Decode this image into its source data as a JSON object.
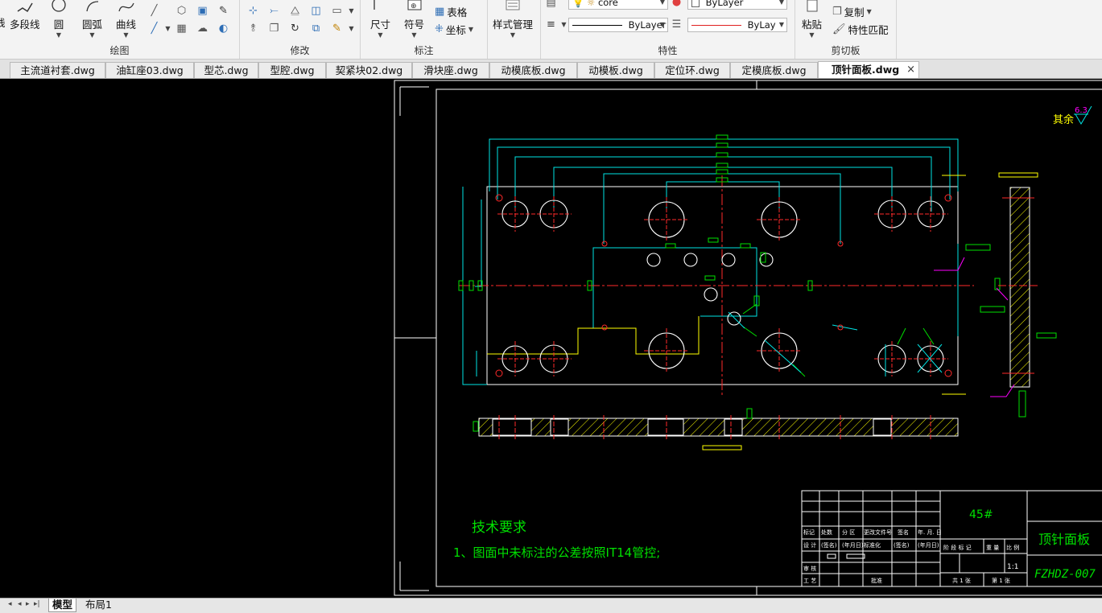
{
  "ribbon": {
    "draw": {
      "title": "绘图",
      "cut_label": "线",
      "polyline": "多段线",
      "circle": "圆",
      "arc": "圆弧",
      "curve": "曲线"
    },
    "modify": {
      "title": "修改"
    },
    "annotate": {
      "title": "标注",
      "dimension": "尺寸",
      "symbol": "符号",
      "table": "表格",
      "coordinate": "坐标"
    },
    "style_manager": "样式管理",
    "properties": {
      "title": "特性",
      "layer_value": "core",
      "color_value": "ByLayer",
      "linetype_value": "ByLayer",
      "lineweight_value": "ByLay"
    },
    "clipboard": {
      "title": "剪切板",
      "paste": "粘贴",
      "copy": "复制",
      "match_props": "特性匹配"
    }
  },
  "tabs": [
    {
      "label": "主流道衬套.dwg",
      "active": false
    },
    {
      "label": "油缸座03.dwg",
      "active": false
    },
    {
      "label": "型芯.dwg",
      "active": false
    },
    {
      "label": "型腔.dwg",
      "active": false
    },
    {
      "label": "契紧块02.dwg",
      "active": false
    },
    {
      "label": "滑块座.dwg",
      "active": false
    },
    {
      "label": "动模底板.dwg",
      "active": false
    },
    {
      "label": "动模板.dwg",
      "active": false
    },
    {
      "label": "定位环.dwg",
      "active": false
    },
    {
      "label": "定模底板.dwg",
      "active": false
    },
    {
      "label": "顶针面板.dwg",
      "active": true
    }
  ],
  "tab_close_glyph": "×",
  "drawing": {
    "surface_rest": "其余",
    "surface_value": "6.3",
    "tech_title": "技术要求",
    "tech_note": "1、图面中未标注的公差按照IT14管控;",
    "material": "45#",
    "part_name": "顶针面板",
    "drawing_no": "FZHDZ-007",
    "scale": "1:1",
    "tb_marks": "标记",
    "tb_count": "处数",
    "tb_zone": "分 区",
    "tb_docno": "更改文件号",
    "tb_sign": "签名",
    "tb_date": "年. 月. 日",
    "tb_design": "设 计",
    "tb_sign2": "(签名)",
    "tb_date2": "(年月日)",
    "tb_std": "标准化",
    "tb_review": "审 核",
    "tb_process": "工 艺",
    "tb_approve": "批准",
    "tb_stage": "阶 段 标 记",
    "tb_weight": "重 量",
    "tb_ratio": "比 例",
    "tb_sheets": "共 1 张",
    "tb_sheet": "第 1 张"
  },
  "layout_tabs": [
    {
      "label": "模型",
      "active": true
    },
    {
      "label": "布局1",
      "active": false
    }
  ],
  "colors": {
    "frame": "#ffffff",
    "cyan": "#00e5e5",
    "red": "#ff2a2a",
    "green": "#00e000",
    "yellow": "#ffff00",
    "magenta": "#ff00ff",
    "orange": "#ff8000"
  }
}
